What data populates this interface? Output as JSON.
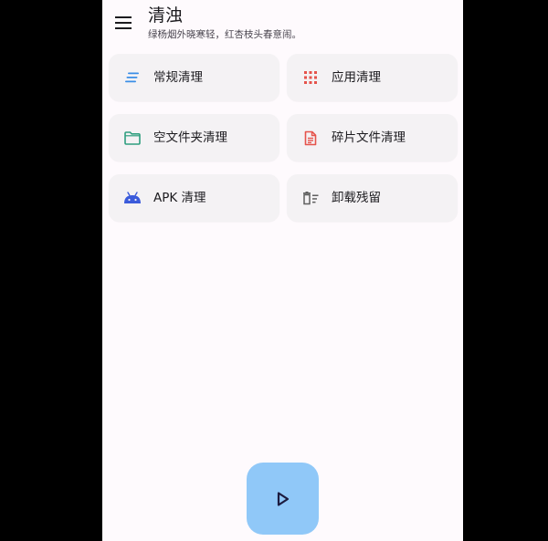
{
  "app": {
    "title": "清浊",
    "subtitle": "绿杨烟外晓寒轻，红杏枝头春意闹。"
  },
  "colors": {
    "background": "#fefafd",
    "card": "#f4f2f4",
    "fab": "#90c8f8"
  },
  "cards": [
    {
      "label": "常规清理",
      "icon": "sort-lines-icon",
      "color": "#3a8ee6"
    },
    {
      "label": "应用清理",
      "icon": "apps-grid-icon",
      "color": "#e5534b"
    },
    {
      "label": "空文件夹清理",
      "icon": "folder-outline-icon",
      "color": "#2e9e7e"
    },
    {
      "label": "碎片文件清理",
      "icon": "document-icon",
      "color": "#e5534b"
    },
    {
      "label": "APK 清理",
      "icon": "android-icon",
      "color": "#3b5bdb"
    },
    {
      "label": "卸载残留",
      "icon": "delete-sweep-icon",
      "color": "#5f5f5f"
    }
  ],
  "fab": {
    "icon": "play-icon"
  }
}
